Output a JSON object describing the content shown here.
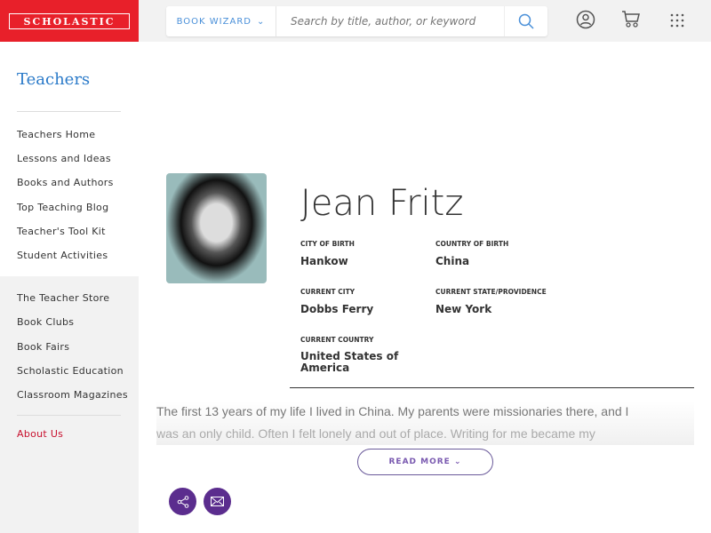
{
  "header": {
    "logo": "SCHOLASTIC",
    "book_wizard": "BOOK WIZARD",
    "search_placeholder": "Search by title, author, or keyword"
  },
  "sidebar": {
    "title": "Teachers",
    "items": [
      "Teachers Home",
      "Lessons and Ideas",
      "Books and Authors",
      "Top Teaching Blog",
      "Teacher's Tool Kit",
      "Student Activities"
    ],
    "items2": [
      "The Teacher Store",
      "Book Clubs",
      "Book Fairs",
      "Scholastic Education",
      "Classroom Magazines"
    ],
    "about": "About Us"
  },
  "author": {
    "name": "Jean Fritz",
    "city_of_birth_label": "CITY OF BIRTH",
    "city_of_birth": "Hankow",
    "country_of_birth_label": "COUNTRY OF BIRTH",
    "country_of_birth": "China",
    "current_city_label": "CURRENT CITY",
    "current_city": "Dobbs Ferry",
    "current_state_label": "CURRENT STATE/PROVIDENCE",
    "current_state": "New York",
    "current_country_label": "CURRENT COUNTRY",
    "current_country": "United States of America"
  },
  "bio": {
    "line1": "The first 13 years of my life I lived in China. My parents were missionaries there, and I",
    "line2": "was an only child. Often I felt lonely and out of place. Writing for me became my",
    "read_more": "READ MORE"
  },
  "colors": {
    "brand": "#e8202a",
    "accent": "#5b2d8e",
    "link": "#2a7ac9"
  }
}
